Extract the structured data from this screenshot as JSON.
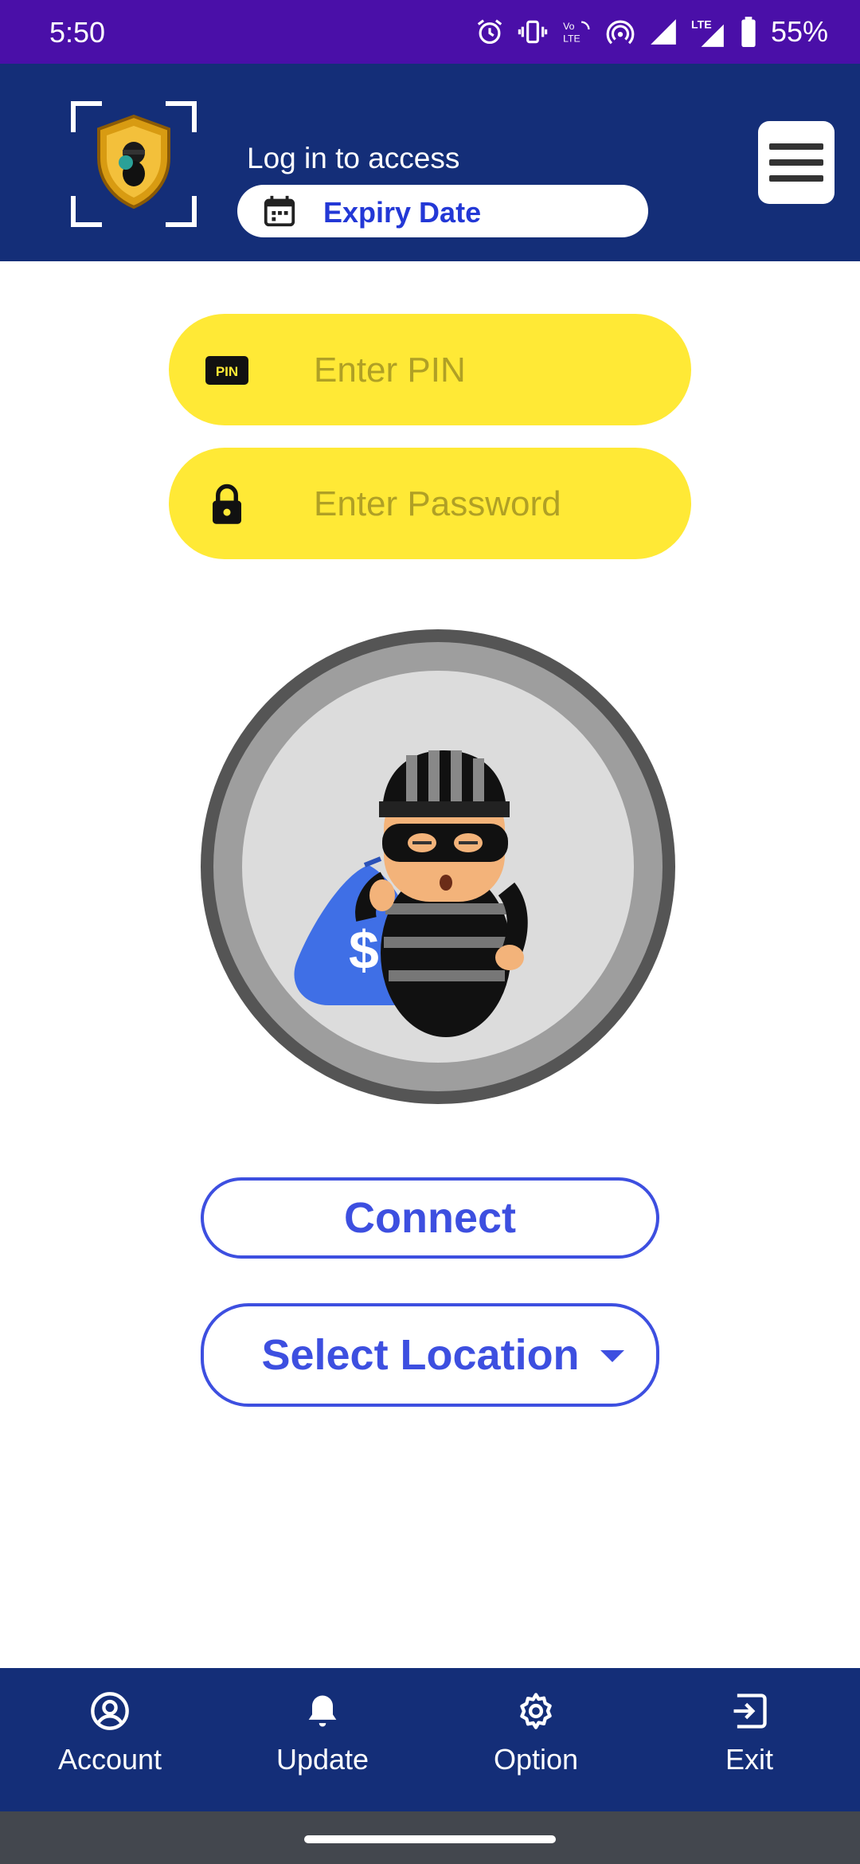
{
  "status_bar": {
    "time": "5:50",
    "battery": "55%"
  },
  "header": {
    "login_text": "Log in to access",
    "expiry_label": "Expiry Date"
  },
  "form": {
    "pin_placeholder": "Enter PIN",
    "pin_value": "",
    "pin_icon_text": "PIN",
    "password_placeholder": "Enter Password",
    "password_value": ""
  },
  "actions": {
    "connect_label": "Connect",
    "location_label": "Select Location"
  },
  "bottom_nav": {
    "items": [
      {
        "label": "Account",
        "icon": "account-circle-icon"
      },
      {
        "label": "Update",
        "icon": "bell-icon"
      },
      {
        "label": "Option",
        "icon": "gear-icon"
      },
      {
        "label": "Exit",
        "icon": "exit-icon"
      }
    ]
  },
  "colors": {
    "status_bar": "#4a0fa8",
    "header": "#142e78",
    "input_fill": "#ffe936",
    "accent": "#3d4fe0"
  }
}
